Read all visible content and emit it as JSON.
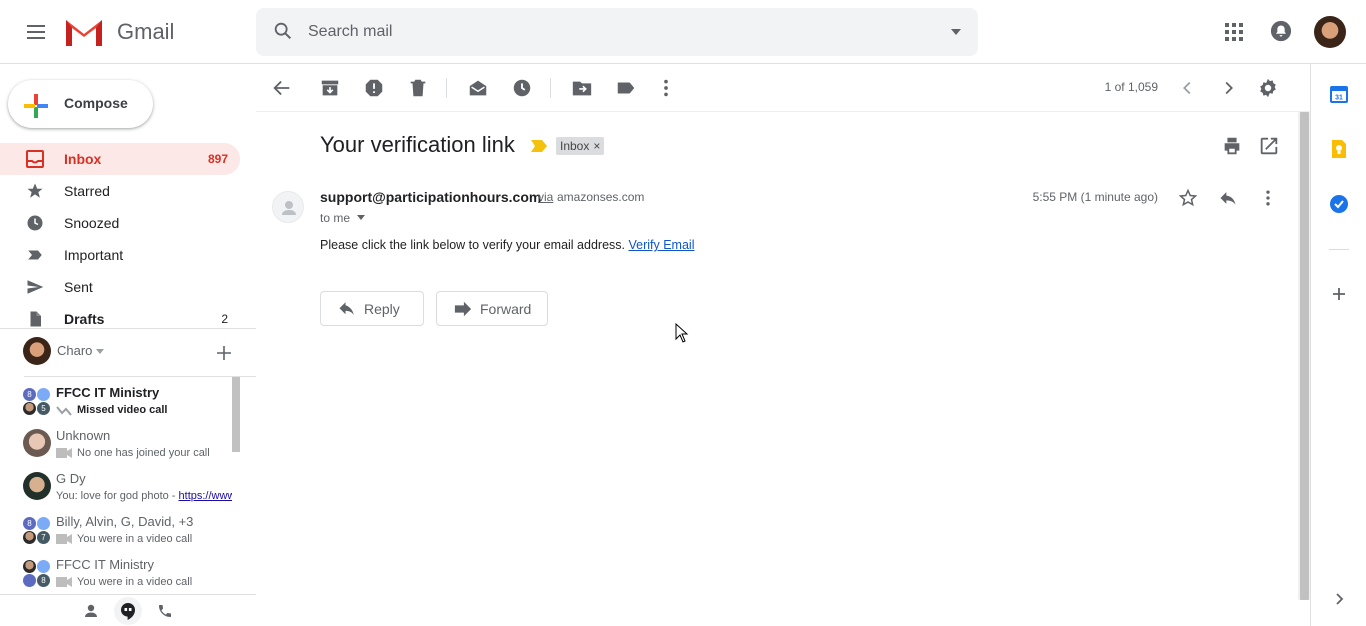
{
  "header": {
    "brand": "Gmail",
    "search_placeholder": "Search mail"
  },
  "nav": {
    "compose_label": "Compose",
    "items": [
      {
        "label": "Inbox",
        "count": "897",
        "icon": "inbox-icon"
      },
      {
        "label": "Starred",
        "count": "",
        "icon": "star-icon"
      },
      {
        "label": "Snoozed",
        "count": "",
        "icon": "clock-icon"
      },
      {
        "label": "Important",
        "count": "",
        "icon": "important-icon"
      },
      {
        "label": "Sent",
        "count": "",
        "icon": "send-icon"
      },
      {
        "label": "Drafts",
        "count": "2",
        "icon": "draft-icon"
      }
    ]
  },
  "hangouts": {
    "user": "Charo",
    "conversations": [
      {
        "name": "FFCC IT Ministry",
        "sub": "Missed video call",
        "unread": true,
        "badge_top": "8",
        "badge_bottom": "5"
      },
      {
        "name": "Unknown",
        "sub": "No one has joined your call",
        "unread": false
      },
      {
        "name": "G Dy",
        "sub_prefix": "You: love for god photo - ",
        "sub_link": "https://www",
        "unread": false
      },
      {
        "name": "Billy, Alvin, G, David, +3",
        "sub": "You were in a video call",
        "unread": false,
        "badge_top": "8",
        "badge_bottom": "7"
      },
      {
        "name": "FFCC IT Ministry",
        "sub": "You were in a video call",
        "unread": false,
        "badge_top": "",
        "badge_bottom": "8"
      }
    ]
  },
  "toolbar": {
    "pager": "1 of 1,059"
  },
  "message": {
    "subject": "Your verification link",
    "label": "Inbox",
    "label_remove": "×",
    "sender_email": "support@participationhours.com",
    "via": "via",
    "via_domain": "amazonses.com",
    "to": "to me",
    "time": "5:55 PM (1 minute ago)",
    "body": "Please click the link below to verify your email address.",
    "link_text": "Verify Email",
    "reply_label": "Reply",
    "forward_label": "Forward"
  },
  "colors": {
    "accent_red": "#d93025",
    "inbox_bg": "#fce8e6",
    "link": "#1155cc",
    "important_marker": "#f4c20d"
  }
}
